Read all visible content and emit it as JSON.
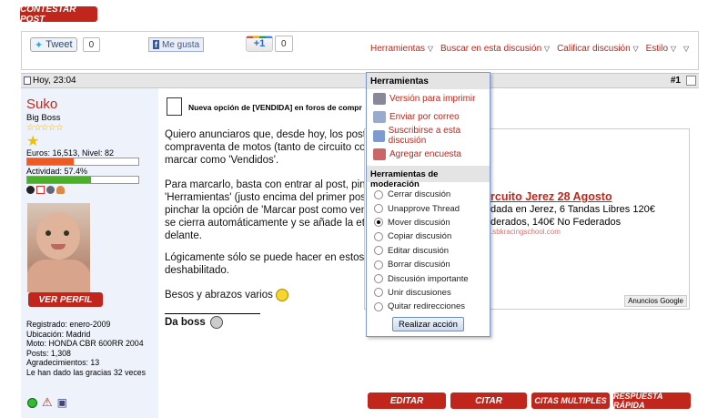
{
  "reply_button": "CONTESTAR POST",
  "social": {
    "tweet_label": "Tweet",
    "tweet_count": "0",
    "like_label": "Me gusta",
    "plus_label": "+1",
    "plus_count": "0"
  },
  "toolbar": {
    "herramientas": "Herramientas",
    "buscar": "Buscar en esta discusión",
    "calificar": "Calificar discusión",
    "estilo": "Estilo"
  },
  "post": {
    "time": "Hoy, 23:04",
    "number": "#1",
    "title": "Nueva opción de [VENDIDA] en foros de compr",
    "paragraph1": [
      "Quiero anunciaros que, desde hoy, los post de l",
      "compraventa de motos (tanto de circuito como d",
      "marcar como 'Vendidos'."
    ],
    "paragraph2": [
      "Para marcarlo, basta con entrar al post, pinchar",
      "'Herramientas' (justo encima del primer post), y",
      "pinchar la opción de 'Marcar post como vendido",
      "se cierra automáticamente y se añade la etique",
      "delante."
    ],
    "paragraph3": [
      "Lógicamente sólo se puede hacer en estos dos",
      "deshabilitado."
    ],
    "closing": "Besos y abrazos varios",
    "signature": "Da boss"
  },
  "user": {
    "name": "Suko",
    "rank": "Big Boss",
    "stars": "☆☆☆☆☆",
    "euros": "Euros: 16,513, Nivel: 82",
    "euros_progress": 0.42,
    "activity": "Actividad: 57.4%",
    "activity_progress": 0.574,
    "profile_button": "VER PERFIL",
    "info": [
      "Registrado: enero-2009",
      "Ubicación: Madrid",
      "Moto: HONDA CBR 600RR 2004",
      "Posts: 1,308",
      "Agradecimientos: 13",
      "Le han dado las gracias 32 veces"
    ]
  },
  "menu": {
    "header": "Herramientas",
    "items": [
      "Versión para imprimir",
      "Enviar por correo",
      "Suscribirse a esta discusión",
      "Agregar encuesta"
    ],
    "mod_header": "Herramientas de moderación",
    "mod_items": [
      "Cerrar discusión",
      "Unapprove Thread",
      "Mover discusión",
      "Copiar discusión",
      "Editar discusión",
      "Borrar discusión",
      "Discusión importante",
      "Unir discusiones",
      "Quitar redirecciones"
    ],
    "selected": "Mover discusión",
    "submit": "Realizar acción"
  },
  "ad": {
    "title": "rcuito Jerez 28 Agosto",
    "line1": "dada en Jerez, 6 Tandas Libres 120€",
    "line2": "derados, 140€ No Federados",
    "url": ".sbkracingschool.com",
    "label": "Anuncios Google"
  },
  "actions": {
    "editar": "EDITAR",
    "citar": "CITAR",
    "citas": "CITAS MULTIPLES",
    "rapida": "RESPUESTA RÁPIDA"
  },
  "colors": {
    "accent": "#c0261b",
    "menu_border": "#7c97c9"
  }
}
